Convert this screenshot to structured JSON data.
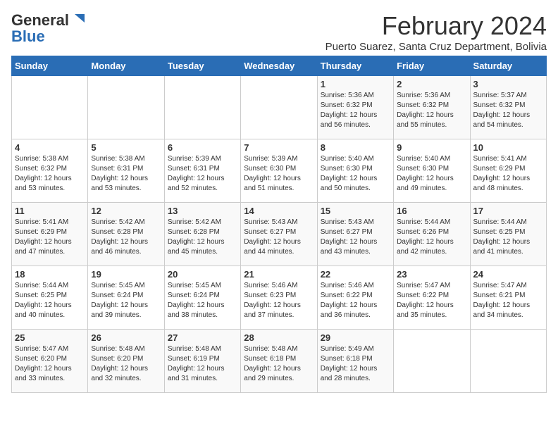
{
  "header": {
    "logo_general": "General",
    "logo_blue": "Blue",
    "month_title": "February 2024",
    "location": "Puerto Suarez, Santa Cruz Department, Bolivia"
  },
  "days_of_week": [
    "Sunday",
    "Monday",
    "Tuesday",
    "Wednesday",
    "Thursday",
    "Friday",
    "Saturday"
  ],
  "weeks": [
    [
      {
        "day": "",
        "info": ""
      },
      {
        "day": "",
        "info": ""
      },
      {
        "day": "",
        "info": ""
      },
      {
        "day": "",
        "info": ""
      },
      {
        "day": "1",
        "info": "Sunrise: 5:36 AM\nSunset: 6:32 PM\nDaylight: 12 hours and 56 minutes."
      },
      {
        "day": "2",
        "info": "Sunrise: 5:36 AM\nSunset: 6:32 PM\nDaylight: 12 hours and 55 minutes."
      },
      {
        "day": "3",
        "info": "Sunrise: 5:37 AM\nSunset: 6:32 PM\nDaylight: 12 hours and 54 minutes."
      }
    ],
    [
      {
        "day": "4",
        "info": "Sunrise: 5:38 AM\nSunset: 6:32 PM\nDaylight: 12 hours and 53 minutes."
      },
      {
        "day": "5",
        "info": "Sunrise: 5:38 AM\nSunset: 6:31 PM\nDaylight: 12 hours and 53 minutes."
      },
      {
        "day": "6",
        "info": "Sunrise: 5:39 AM\nSunset: 6:31 PM\nDaylight: 12 hours and 52 minutes."
      },
      {
        "day": "7",
        "info": "Sunrise: 5:39 AM\nSunset: 6:30 PM\nDaylight: 12 hours and 51 minutes."
      },
      {
        "day": "8",
        "info": "Sunrise: 5:40 AM\nSunset: 6:30 PM\nDaylight: 12 hours and 50 minutes."
      },
      {
        "day": "9",
        "info": "Sunrise: 5:40 AM\nSunset: 6:30 PM\nDaylight: 12 hours and 49 minutes."
      },
      {
        "day": "10",
        "info": "Sunrise: 5:41 AM\nSunset: 6:29 PM\nDaylight: 12 hours and 48 minutes."
      }
    ],
    [
      {
        "day": "11",
        "info": "Sunrise: 5:41 AM\nSunset: 6:29 PM\nDaylight: 12 hours and 47 minutes."
      },
      {
        "day": "12",
        "info": "Sunrise: 5:42 AM\nSunset: 6:28 PM\nDaylight: 12 hours and 46 minutes."
      },
      {
        "day": "13",
        "info": "Sunrise: 5:42 AM\nSunset: 6:28 PM\nDaylight: 12 hours and 45 minutes."
      },
      {
        "day": "14",
        "info": "Sunrise: 5:43 AM\nSunset: 6:27 PM\nDaylight: 12 hours and 44 minutes."
      },
      {
        "day": "15",
        "info": "Sunrise: 5:43 AM\nSunset: 6:27 PM\nDaylight: 12 hours and 43 minutes."
      },
      {
        "day": "16",
        "info": "Sunrise: 5:44 AM\nSunset: 6:26 PM\nDaylight: 12 hours and 42 minutes."
      },
      {
        "day": "17",
        "info": "Sunrise: 5:44 AM\nSunset: 6:25 PM\nDaylight: 12 hours and 41 minutes."
      }
    ],
    [
      {
        "day": "18",
        "info": "Sunrise: 5:44 AM\nSunset: 6:25 PM\nDaylight: 12 hours and 40 minutes."
      },
      {
        "day": "19",
        "info": "Sunrise: 5:45 AM\nSunset: 6:24 PM\nDaylight: 12 hours and 39 minutes."
      },
      {
        "day": "20",
        "info": "Sunrise: 5:45 AM\nSunset: 6:24 PM\nDaylight: 12 hours and 38 minutes."
      },
      {
        "day": "21",
        "info": "Sunrise: 5:46 AM\nSunset: 6:23 PM\nDaylight: 12 hours and 37 minutes."
      },
      {
        "day": "22",
        "info": "Sunrise: 5:46 AM\nSunset: 6:22 PM\nDaylight: 12 hours and 36 minutes."
      },
      {
        "day": "23",
        "info": "Sunrise: 5:47 AM\nSunset: 6:22 PM\nDaylight: 12 hours and 35 minutes."
      },
      {
        "day": "24",
        "info": "Sunrise: 5:47 AM\nSunset: 6:21 PM\nDaylight: 12 hours and 34 minutes."
      }
    ],
    [
      {
        "day": "25",
        "info": "Sunrise: 5:47 AM\nSunset: 6:20 PM\nDaylight: 12 hours and 33 minutes."
      },
      {
        "day": "26",
        "info": "Sunrise: 5:48 AM\nSunset: 6:20 PM\nDaylight: 12 hours and 32 minutes."
      },
      {
        "day": "27",
        "info": "Sunrise: 5:48 AM\nSunset: 6:19 PM\nDaylight: 12 hours and 31 minutes."
      },
      {
        "day": "28",
        "info": "Sunrise: 5:48 AM\nSunset: 6:18 PM\nDaylight: 12 hours and 29 minutes."
      },
      {
        "day": "29",
        "info": "Sunrise: 5:49 AM\nSunset: 6:18 PM\nDaylight: 12 hours and 28 minutes."
      },
      {
        "day": "",
        "info": ""
      },
      {
        "day": "",
        "info": ""
      }
    ]
  ]
}
